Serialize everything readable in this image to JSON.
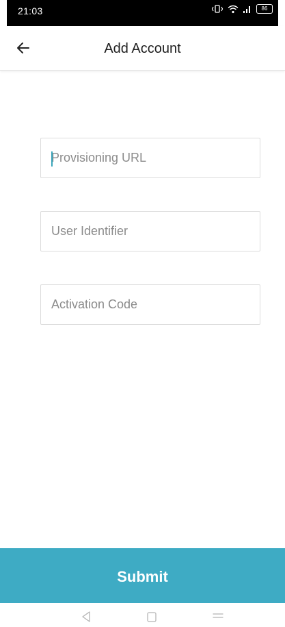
{
  "status_bar": {
    "time": "21:03",
    "battery": "86"
  },
  "header": {
    "title": "Add Account"
  },
  "form": {
    "provisioning_url": {
      "placeholder": "Provisioning URL",
      "value": ""
    },
    "user_identifier": {
      "placeholder": "User Identifier",
      "value": ""
    },
    "activation_code": {
      "placeholder": "Activation Code",
      "value": ""
    }
  },
  "submit": {
    "label": "Submit"
  },
  "colors": {
    "accent": "#3eabc4",
    "caret": "#3aa6bb",
    "placeholder": "#8b8b8b"
  },
  "icons": {
    "back": "arrow-left-icon",
    "nav_back": "triangle-back-icon",
    "nav_home": "square-home-icon",
    "nav_menu": "menu-lines-icon"
  }
}
